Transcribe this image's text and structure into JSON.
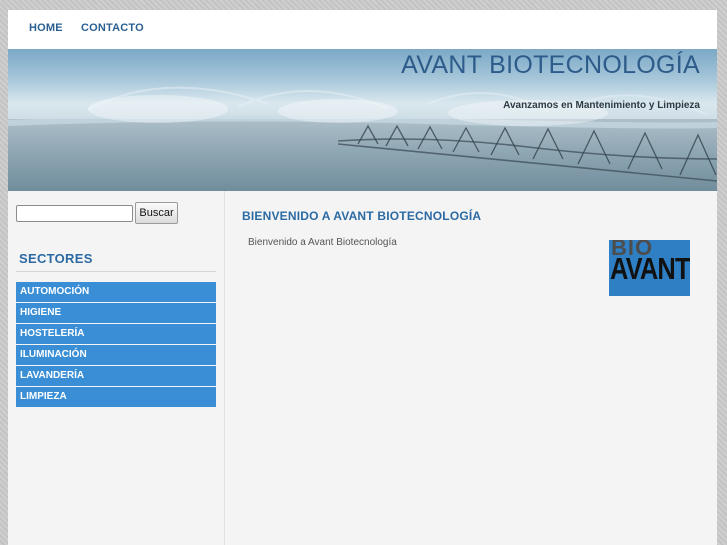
{
  "nav": {
    "home": "HOME",
    "contacto": "CONTACTO"
  },
  "header": {
    "title": "AVANT BIOTECNOLOGÍA",
    "tagline": "Avanzamos en Mantenimiento y Limpieza"
  },
  "search": {
    "value": "",
    "button_label": "Buscar"
  },
  "sidebar": {
    "title": "SECTORES",
    "items": [
      "AUTOMOCIÓN",
      "HIGIENE",
      "HOSTELERÍA",
      "ILUMINACIÓN",
      "LAVANDERÍA",
      "LIMPIEZA"
    ]
  },
  "main": {
    "title": "BIENVENIDO A AVANT BIOTECNOLOGÍA",
    "text": "Bienvenido a Avant Biotecnología",
    "logo": {
      "top": "BIO",
      "bottom": "AVANT"
    }
  }
}
